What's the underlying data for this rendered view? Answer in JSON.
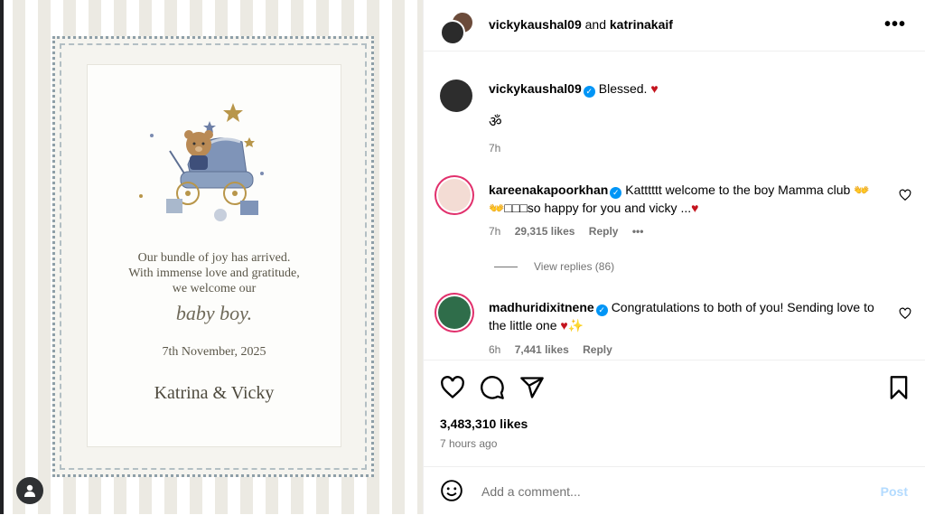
{
  "post": {
    "header": {
      "user1": "vickykaushal09",
      "conj": "and",
      "user2": "katrinakaif",
      "more": "•••"
    },
    "caption": {
      "username": "vickykaushal09",
      "text": "Blessed. ",
      "heart": "♥",
      "symbol": "ॐ",
      "time": "7h"
    },
    "comments": [
      {
        "username": "kareenakapoorkhan",
        "text": "Katttttt welcome to the boy Mamma club 👐👐□□□so happy for you and vicky ...",
        "heart": "♥",
        "time": "7h",
        "likes": "29,315 likes",
        "reply": "Reply",
        "more": "•••",
        "view_replies": "View replies (86)"
      },
      {
        "username": "madhuridixitnene",
        "text": "Congratulations to both of you! Sending love to the little one ",
        "heart": "♥✨",
        "time": "6h",
        "likes": "7,441 likes",
        "reply": "Reply"
      }
    ],
    "likes": "3,483,310 likes",
    "posted": "7 hours ago",
    "add_comment": {
      "placeholder": "Add a comment...",
      "post": "Post"
    }
  },
  "card": {
    "line1": "Our bundle of joy has arrived.",
    "line2": "With immense love and gratitude,",
    "line3": "we welcome our",
    "baby": "baby boy.",
    "date": "7th November, 2025",
    "names": "Katrina & Vicky"
  },
  "colors": {
    "accent": "#0095f6",
    "heart": "#c4141e",
    "muted": "#737373"
  }
}
